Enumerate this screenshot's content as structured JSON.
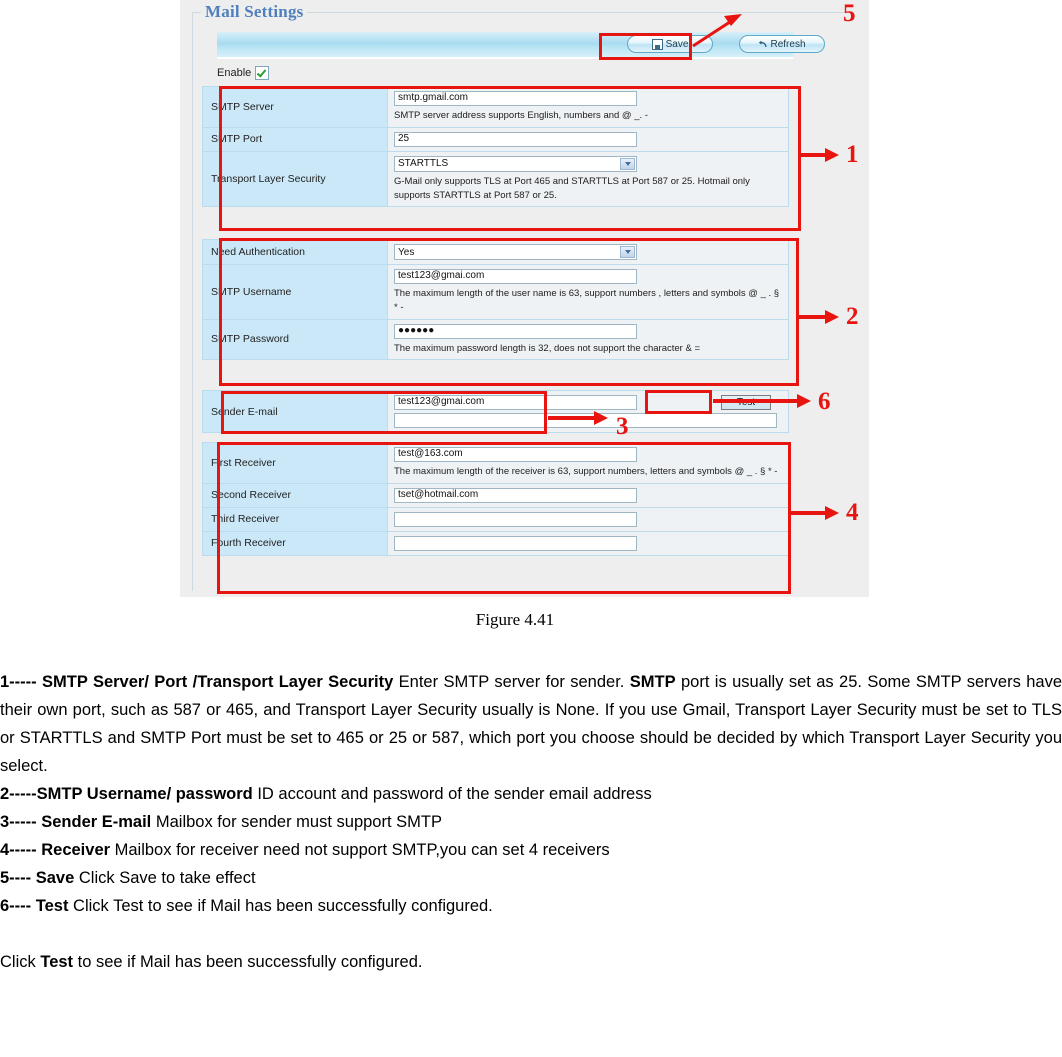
{
  "screenshot": {
    "panel_title": "Mail Settings",
    "toolbar": {
      "save_label": "Save",
      "refresh_label": "Refresh"
    },
    "enable": {
      "label": "Enable",
      "checked": "true"
    },
    "rows": [
      {
        "label": "SMTP Server",
        "value": "smtp.gmail.com",
        "hint": "SMTP server address supports English, numbers and @ _. -"
      },
      {
        "label": "SMTP Port",
        "value": "25",
        "hint": ""
      },
      {
        "label": "Transport Layer Security",
        "value": "STARTTLS",
        "hint": "G-Mail only supports TLS at Port 465 and STARTTLS at Port 587 or 25. Hotmail only supports STARTTLS at Port 587 or 25."
      },
      {
        "label": "Need Authentication",
        "value": "Yes",
        "hint": ""
      },
      {
        "label": "SMTP Username",
        "value": "test123@gmai.com",
        "hint": "The maximum length of the user name is 63, support numbers , letters and symbols @ _ . § * -"
      },
      {
        "label": "SMTP Password",
        "value": "●●●●●●",
        "hint": "The maximum password length is 32, does not support the character & ="
      },
      {
        "label": "Sender E-mail",
        "value": "test123@gmai.com",
        "value2": "",
        "test_label": "Test",
        "hint": ""
      },
      {
        "label": "First Receiver",
        "value": "test@163.com",
        "hint": "The maximum length of the receiver is 63, support numbers, letters and symbols @ _ . § * -"
      },
      {
        "label": "Second Receiver",
        "value": "tset@hotmail.com",
        "hint": ""
      },
      {
        "label": "Third Receiver",
        "value": "",
        "hint": ""
      },
      {
        "label": "Fourth Receiver",
        "value": "",
        "hint": ""
      }
    ],
    "annotations": [
      {
        "id": "1",
        "number": "1"
      },
      {
        "id": "2",
        "number": "2"
      },
      {
        "id": "3",
        "number": "3"
      },
      {
        "id": "4",
        "number": "4"
      },
      {
        "id": "5",
        "number": "5"
      },
      {
        "id": "6",
        "number": "6"
      }
    ],
    "accent_color": "#e8140f"
  },
  "caption": "Figure 4.41",
  "body": {
    "item1": {
      "bold": "1----- SMTP Server/ Port /Transport Layer Security",
      "text_a": "  Enter SMTP server for sender. ",
      "bold_inline": "SMTP",
      "text_b": " port is usually set as 25. Some SMTP servers have their own port, such as 587 or 465, and Transport Layer Security usually is None. If you use Gmail, Transport Layer Security must be set to TLS or STARTTLS and SMTP Port must be set to 465 or 25 or 587, which port you choose should be decided by which Transport Layer Security you select."
    },
    "item2": {
      "bold": "2-----SMTP Username/ password",
      "text": "  ID account and password of the sender email address"
    },
    "item3": {
      "bold": "3----- Sender E-mail",
      "text": "  Mailbox for sender must support SMTP"
    },
    "item4": {
      "bold": "4----- Receiver",
      "text": "  Mailbox for receiver need not support SMTP,you can set 4 receivers"
    },
    "item5": {
      "bold": "5---- Save",
      "text": "  Click Save to take effect"
    },
    "item6": {
      "bold": "6---- Test",
      "text": "  Click Test to see if Mail has been successfully configured."
    },
    "closing": {
      "text_a": "Click ",
      "bold_inline": "Test",
      "text_b": " to see if Mail has been successfully configured."
    }
  }
}
